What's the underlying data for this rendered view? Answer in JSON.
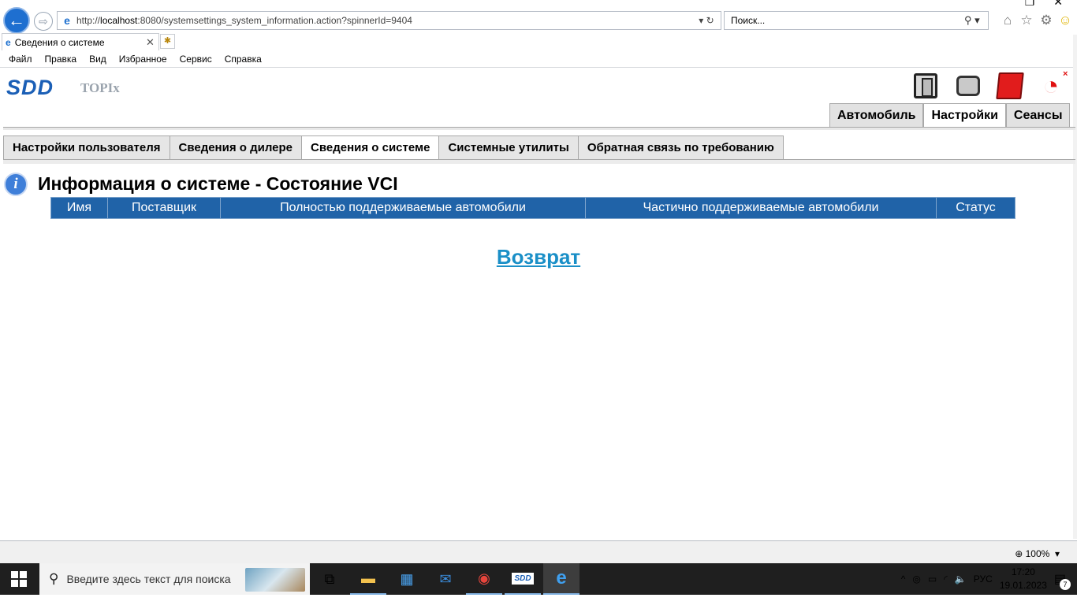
{
  "browser": {
    "address_prefix": "http://",
    "address_host": "localhost",
    "address_rest": ":8080/systemsettings_system_information.action?spinnerId=9404",
    "search_placeholder": "Поиск...",
    "tab_title": "Сведения о системе",
    "menu": [
      "Файл",
      "Правка",
      "Вид",
      "Избранное",
      "Сервис",
      "Справка"
    ],
    "zoom": "100%"
  },
  "app": {
    "logo_sdd": "SDD",
    "logo_topix": "TOPIx",
    "main_tabs": [
      "Автомобиль",
      "Настройки",
      "Сеансы"
    ],
    "active_main_tab": "Настройки",
    "sub_tabs": [
      "Настройки пользователя",
      "Сведения о дилере",
      "Сведения о системе",
      "Системные утилиты",
      "Обратная связь по требованию"
    ],
    "active_sub_tab": "Сведения о системе",
    "page_title": "Информация о системе - Состояние VCI",
    "table_headers": [
      "Имя",
      "Поставщик",
      "Полностью поддерживаемые автомобили",
      "Частично поддерживаемые автомобили",
      "Статус"
    ],
    "back_link": "Возврат",
    "colors": {
      "table_header": "#2063a8",
      "link": "#1a8fc7",
      "logo": "#1b5fb6"
    }
  },
  "taskbar": {
    "search_placeholder": "Введите здесь текст для поиска",
    "language": "РУС",
    "time": "17:20",
    "date": "19.01.2023",
    "notifications": "7",
    "apps": [
      "task-view-icon",
      "file-explorer-icon",
      "store-icon",
      "mail-icon",
      "chrome-icon",
      "sdd-icon",
      "internet-explorer-icon"
    ]
  }
}
